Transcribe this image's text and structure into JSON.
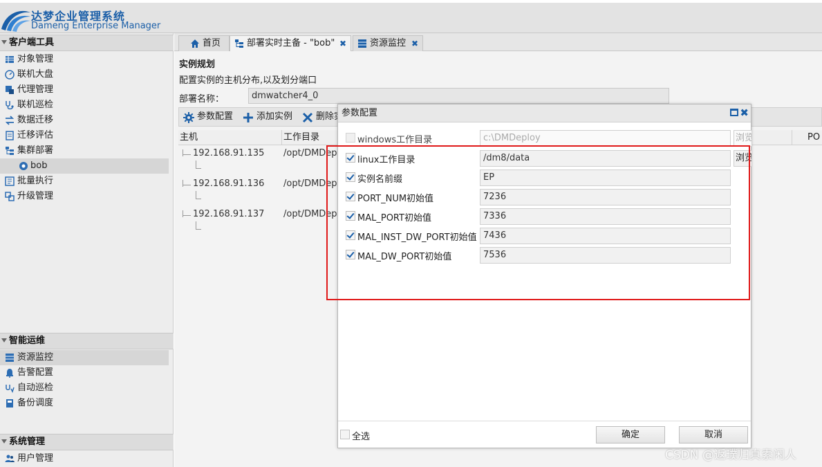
{
  "app": {
    "name_cn": "达梦企业管理系统",
    "name_en": "Dameng Enterprise Manager",
    "brand_color": "#1b5fa8"
  },
  "sidebar": {
    "sections": [
      {
        "label": "客户端工具"
      },
      {
        "label": "智能运维"
      },
      {
        "label": "系统管理"
      }
    ],
    "client_tools": [
      {
        "label": "对象管理",
        "icon": "table-icon"
      },
      {
        "label": "联机大盘",
        "icon": "gauge-icon"
      },
      {
        "label": "代理管理",
        "icon": "agent-icon"
      },
      {
        "label": "联机巡检",
        "icon": "stethoscope-icon"
      },
      {
        "label": "数据迁移",
        "icon": "transfer-icon"
      },
      {
        "label": "迁移评估",
        "icon": "report-icon"
      },
      {
        "label": "集群部署",
        "icon": "cluster-icon"
      },
      {
        "label": "bob",
        "icon": "deploy-node-icon"
      },
      {
        "label": "批量执行",
        "icon": "batch-icon"
      },
      {
        "label": "升级管理",
        "icon": "upgrade-icon"
      }
    ],
    "ops": [
      {
        "label": "资源监控",
        "icon": "monitor-icon"
      },
      {
        "label": "告警配置",
        "icon": "alarm-icon"
      },
      {
        "label": "自动巡检",
        "icon": "auto-inspect-icon"
      },
      {
        "label": "备份调度",
        "icon": "backup-icon"
      }
    ],
    "system": [
      {
        "label": "用户管理",
        "icon": "users-icon"
      }
    ]
  },
  "tabs": [
    {
      "label": "首页",
      "icon": "home-icon"
    },
    {
      "label": "部署实时主备 - \"bob\"",
      "icon": "deploy-icon",
      "close": "✖"
    },
    {
      "label": "资源监控",
      "icon": "monitor-icon",
      "close": "✖"
    }
  ],
  "page": {
    "title": "实例规划",
    "description": "配置实例的主机分布,以及划分端口",
    "deploy_name_label": "部署名称：",
    "deploy_name_value": "dmwatcher4_0"
  },
  "toolbar": {
    "param_config": "参数配置",
    "add_instance": "添加实例",
    "delete_instance": "删除实"
  },
  "grid": {
    "columns": [
      "主机",
      "工作目录"
    ],
    "right_column": "PO",
    "rows": [
      {
        "host": "192.168.91.135",
        "workdir": "/opt/DMDep"
      },
      {
        "host": "192.168.91.136",
        "workdir": "/opt/DMDep"
      },
      {
        "host": "192.168.91.137",
        "workdir": "/opt/DMDep"
      }
    ]
  },
  "dialog": {
    "title": "参数配置",
    "params": [
      {
        "label": "windows工作目录",
        "value": "c:\\DMDeploy",
        "checked": false,
        "disabled": true,
        "browse": "浏览"
      },
      {
        "label": "linux工作目录",
        "value": "/dm8/data",
        "checked": true,
        "disabled": false,
        "browse": "浏览"
      },
      {
        "label": "实例名前缀",
        "value": "EP",
        "checked": true,
        "disabled": false
      },
      {
        "label": "PORT_NUM初始值",
        "value": "7236",
        "checked": true,
        "disabled": false
      },
      {
        "label": "MAL_PORT初始值",
        "value": "7336",
        "checked": true,
        "disabled": false
      },
      {
        "label": "MAL_INST_DW_PORT初始值",
        "value": "7436",
        "checked": true,
        "disabled": false
      },
      {
        "label": "MAL_DW_PORT初始值",
        "value": "7536",
        "checked": true,
        "disabled": false
      }
    ],
    "select_all": "全选",
    "ok": "确定",
    "cancel": "取消"
  },
  "annotation": {
    "highlight_color": "#e01818"
  },
  "watermark": "CSDN @返璞归真素闲人"
}
